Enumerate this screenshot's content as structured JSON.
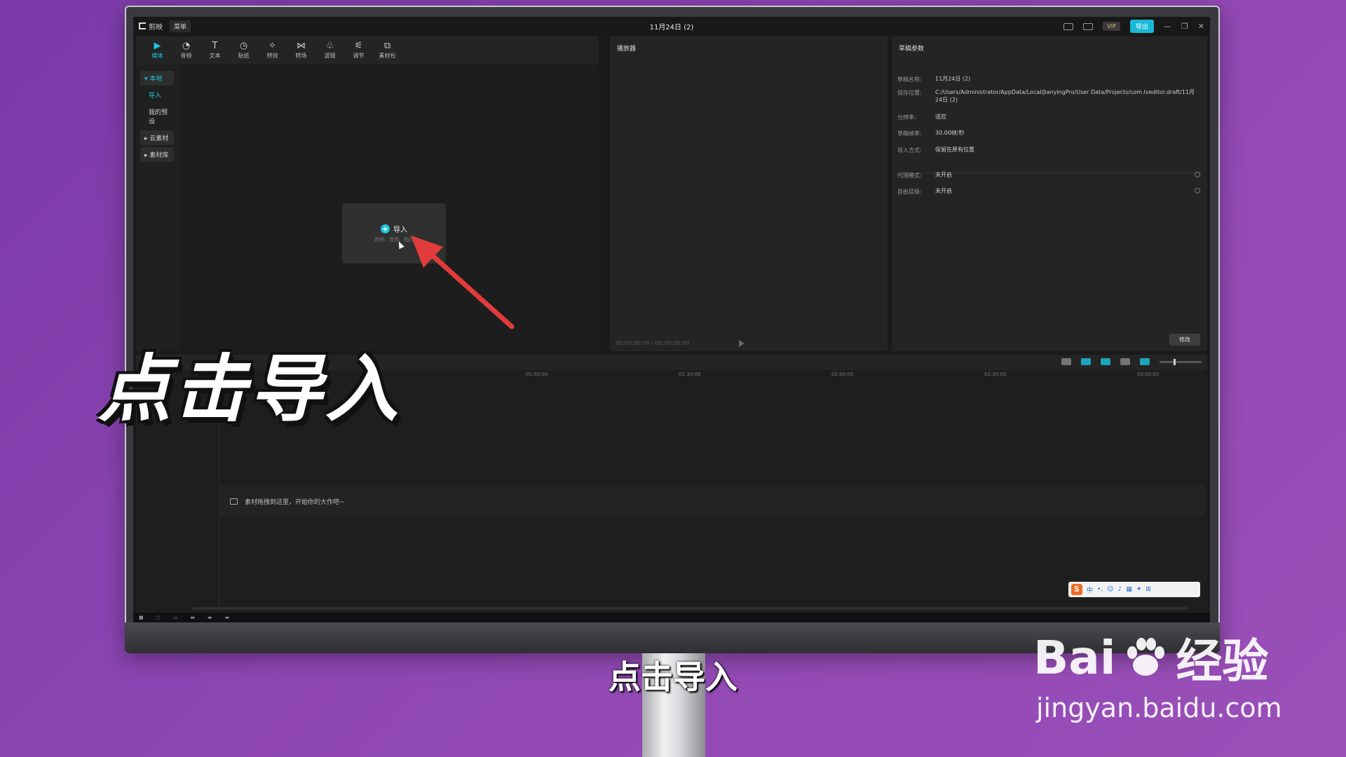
{
  "app": {
    "name": "剪映",
    "menu_label": "菜单",
    "project_title": "11月24日 (2)",
    "vip_label": "VIP",
    "export_label": "导出"
  },
  "toolbar": {
    "tools": [
      {
        "label": "媒体",
        "icon": "media-icon"
      },
      {
        "label": "音频",
        "icon": "audio-icon"
      },
      {
        "label": "文本",
        "icon": "text-icon"
      },
      {
        "label": "贴纸",
        "icon": "sticker-icon"
      },
      {
        "label": "特效",
        "icon": "effects-icon"
      },
      {
        "label": "转场",
        "icon": "transition-icon"
      },
      {
        "label": "滤镜",
        "icon": "filter-icon"
      },
      {
        "label": "调节",
        "icon": "adjust-icon"
      },
      {
        "label": "素材包",
        "icon": "package-icon"
      }
    ]
  },
  "sidebar": {
    "local": "本地",
    "import": "导入",
    "presets": "我的预设",
    "cloud": "云素材",
    "library": "素材库"
  },
  "import_card": {
    "label": "导入",
    "hint": "视频、音频、图片"
  },
  "player": {
    "title": "播放器",
    "timecode": "00:00:00:00 / 00:00:00:00"
  },
  "draft": {
    "title": "草稿参数",
    "rows": [
      {
        "key": "草稿名称:",
        "value": "11月24日 (2)"
      },
      {
        "key": "保存位置:",
        "value": "C:/Users/Administrator/AppData/Local/JianyingPro/User Data/Projects/com.lveditor.draft/11月24日 (2)"
      },
      {
        "key": "分辨率:",
        "value": "适应"
      },
      {
        "key": "草稿帧率:",
        "value": "30.00帧/秒"
      },
      {
        "key": "导入方式:",
        "value": "保留在原有位置"
      },
      {
        "key": "代理模式:",
        "value": "未开启"
      },
      {
        "key": "自由层级:",
        "value": "未开启"
      }
    ],
    "modify_label": "修改"
  },
  "timeline": {
    "ticks": [
      "01:00:00",
      "01:30:00",
      "02:00:00",
      "02:30:00",
      "03:00:00"
    ],
    "drop_hint": "素材拖拽到这里，开始你的大作吧~"
  },
  "ime": {
    "lang": "中"
  },
  "overlay": {
    "big_caption": "点击导入",
    "subtitle": "点击导入",
    "watermark_brand": "Bai",
    "watermark_brand2": "经验",
    "watermark_url": "jingyan.baidu.com"
  },
  "colors": {
    "accent": "#1cc4e0",
    "arrow": "#e23b3b",
    "background": "#8e46b3"
  }
}
